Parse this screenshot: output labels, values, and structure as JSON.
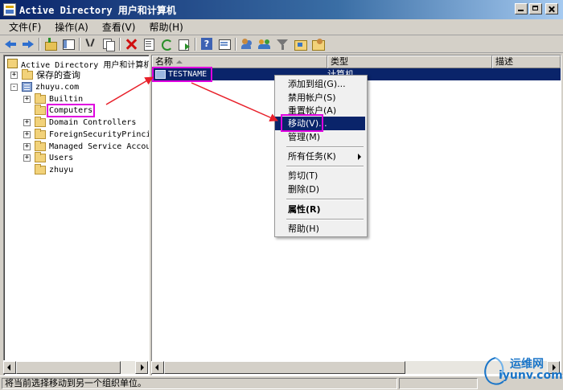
{
  "window": {
    "title": "Active Directory 用户和计算机"
  },
  "menubar": {
    "items": [
      "文件(F)",
      "操作(A)",
      "查看(V)",
      "帮助(H)"
    ]
  },
  "toolbar": {
    "icons": [
      "back-icon",
      "forward-icon",
      "up-icon",
      "show-hide-tree-icon",
      "cut-icon",
      "copy-icon",
      "delete-icon",
      "properties-icon",
      "refresh-icon",
      "export-icon",
      "help-icon",
      "view-icon",
      "new-user-icon",
      "new-group-icon",
      "filter-icon",
      "new-ou-icon",
      "delegate-icon"
    ]
  },
  "tree": {
    "root": "Active Directory 用户和计算机",
    "saved_queries": "保存的查询",
    "domain": "zhuyu.com",
    "containers": [
      "Builtin",
      "Computers",
      "Domain Controllers",
      "ForeignSecurityPrincip",
      "Managed Service Accour",
      "Users",
      "zhuyu"
    ],
    "expanders": {
      "plus": "+",
      "minus": "-"
    }
  },
  "list": {
    "columns": {
      "name": "名称",
      "type": "类型",
      "description": "描述"
    },
    "rows": [
      {
        "name": "TESTNAME",
        "type": "计算机"
      }
    ]
  },
  "context_menu": {
    "items": [
      "添加到组(G)...",
      "禁用帐户(S)",
      "重置帐户(A)",
      "移动(V)...",
      "管理(M)",
      "所有任务(K)",
      "剪切(T)",
      "删除(D)",
      "属性(R)",
      "帮助(H)"
    ]
  },
  "status": {
    "text": "将当前选择移动到另一个组织单位。"
  },
  "watermark": {
    "name": "运维网",
    "url": "iyunv.com"
  },
  "colors": {
    "highlight": "#0a246a",
    "annotation": "#e000e0",
    "arrow": "#e8202a"
  }
}
